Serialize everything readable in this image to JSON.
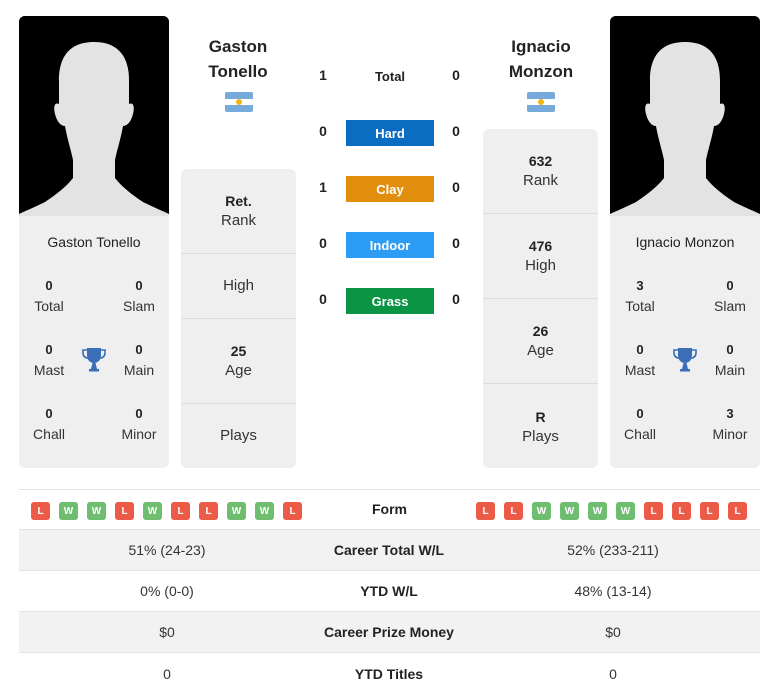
{
  "player1": {
    "name": "Gaston Tonello",
    "header_first": "Gaston",
    "header_last": "Tonello",
    "flag": "argentina-flag",
    "titles": {
      "total": "0",
      "slam": "0",
      "mast": "0",
      "main": "0",
      "chall": "0",
      "minor": "0"
    },
    "info": {
      "rank_value": "Ret.",
      "rank_label": "Rank",
      "high_value": "",
      "high_label": "High",
      "age_value": "25",
      "age_label": "Age",
      "plays_value": "",
      "plays_label": "Plays"
    },
    "form": [
      "L",
      "W",
      "W",
      "L",
      "W",
      "L",
      "L",
      "W",
      "W",
      "L"
    ]
  },
  "player2": {
    "name": "Ignacio Monzon",
    "header_first": "Ignacio",
    "header_last": "Monzon",
    "flag": "argentina-flag",
    "titles": {
      "total": "3",
      "slam": "0",
      "mast": "0",
      "main": "0",
      "chall": "0",
      "minor": "3"
    },
    "info": {
      "rank_value": "632",
      "rank_label": "Rank",
      "high_value": "476",
      "high_label": "High",
      "age_value": "26",
      "age_label": "Age",
      "plays_value": "R",
      "plays_label": "Plays"
    },
    "form": [
      "L",
      "L",
      "W",
      "W",
      "W",
      "W",
      "L",
      "L",
      "L",
      "L"
    ]
  },
  "title_labels": {
    "total": "Total",
    "slam": "Slam",
    "mast": "Mast",
    "main": "Main",
    "chall": "Chall",
    "minor": "Minor"
  },
  "h2h": {
    "total_label": "Total",
    "total": {
      "p1": "1",
      "p2": "0"
    },
    "surfaces": [
      {
        "label": "Hard",
        "p1": "0",
        "p2": "0",
        "color": "#0b6dc1"
      },
      {
        "label": "Clay",
        "p1": "1",
        "p2": "0",
        "color": "#e08e0b"
      },
      {
        "label": "Indoor",
        "p1": "0",
        "p2": "0",
        "color": "#2d9cf5"
      },
      {
        "label": "Grass",
        "p1": "0",
        "p2": "0",
        "color": "#0b9443"
      }
    ]
  },
  "form_label": "Form",
  "stats": [
    {
      "label": "Career Total W/L",
      "p1": "51% (24-23)",
      "p2": "52% (233-211)"
    },
    {
      "label": "YTD W/L",
      "p1": "0% (0-0)",
      "p2": "48% (13-14)"
    },
    {
      "label": "Career Prize Money",
      "p1": "$0",
      "p2": "$0"
    },
    {
      "label": "YTD Titles",
      "p1": "0",
      "p2": "0"
    }
  ],
  "colors": {
    "win": "#6fbe6f",
    "loss": "#ec5b47",
    "trophy": "#3a6fb7"
  }
}
